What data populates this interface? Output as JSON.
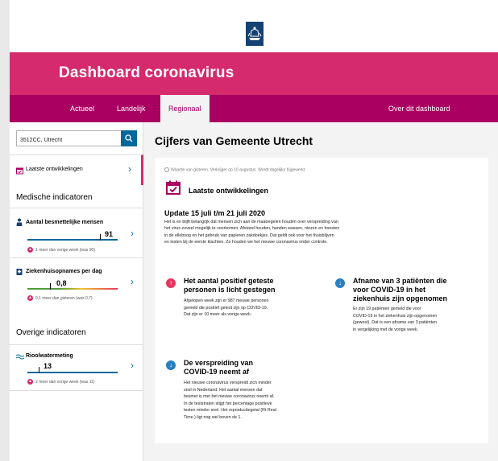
{
  "header": {
    "title": "Dashboard coronavirus"
  },
  "nav": {
    "tabs": [
      "Actueel",
      "Landelijk",
      "Regionaal",
      "Over dit dashboard"
    ]
  },
  "search": {
    "value": "3512CC, Utrecht"
  },
  "sidebar": {
    "latest": "Laatste ontwikkelingen",
    "medical_title": "Medische indicatoren",
    "other_title": "Overige indicatoren",
    "indicators": [
      {
        "label": "Aantal besmettelijke mensen",
        "value": "91",
        "delta": "1 meer dan vorige week (was 90)"
      },
      {
        "label": "Ziekenhuisopnames per dag",
        "value": "0,8",
        "delta": "0,1 meer dan gisteren (was 0,7)"
      },
      {
        "label": "Rioolwatermeting",
        "value": "13",
        "delta": "2 meer dan vorige week (was 11)"
      }
    ]
  },
  "main": {
    "title": "Cijfers van Gemeente Utrecht",
    "note": "Waarde van gisteren. Verkrijger op 10 augustus. Wordt dagelijks bijgewerkt.",
    "section": "Laatste ontwikkelingen",
    "update": "Update 15 juli t/m 21 juli 2020",
    "paragraph_lines": [
      "Het is en blijft belangrijk dat mensen zich aan de maatregelen houden over verspreiding van",
      "het virus zoveel mogelijk te voorkomen. Afstand houden, handen wassen, niezen en hoesten",
      "in de elleboog en het gebruik van papieren zakdoekjes. Dat geldt ook voor het thuisblijven",
      "en testen bij de eerste klachten. Zo houden we het nieuwe coronavirus onder controle."
    ],
    "blocks": [
      {
        "title_lines": [
          "Het aantal positief geteste",
          "personen is licht gestegen"
        ],
        "text_lines": [
          "Afgelopen week zijn er 987 nieuwe personen",
          "gemeld die positief getest zijn op COVID-19.",
          "Dat zijn er 10 meer als vorige week."
        ]
      },
      {
        "title_lines": [
          "Afname van 3 patiënten die",
          "voor COVID-19 in het",
          "ziekenhuis zijn opgenomen"
        ],
        "text_lines": [
          "Er zijn 19 patiënten gemeld die voor",
          "COVID-19 in het ziekenhuis zijn opgenomen",
          "(gewest). Dat is een afname van 3 patiënten",
          "in vergelijking met de vorige week."
        ]
      },
      {
        "title_lines": [
          "De verspreiding van",
          "COVID-19 neemt af"
        ],
        "text_lines": [
          "Het nieuwe coronavirus verspreidt zich minder",
          "snel in Nederland. Het aantal mensen dat",
          "besmet is met het nieuwe coronavirus neemt af.",
          "In de teststraten stijgt het percentage positieve",
          "testen minder snel. Het reproductiegetal (Rt Real",
          "Time ) ligt nog wel boven de 1."
        ]
      }
    ]
  },
  "colors": {
    "brand": "#d52b6d",
    "nav": "#a90061",
    "accent": "#01689b",
    "up": "#e8375f",
    "down": "#2a7fc1"
  }
}
